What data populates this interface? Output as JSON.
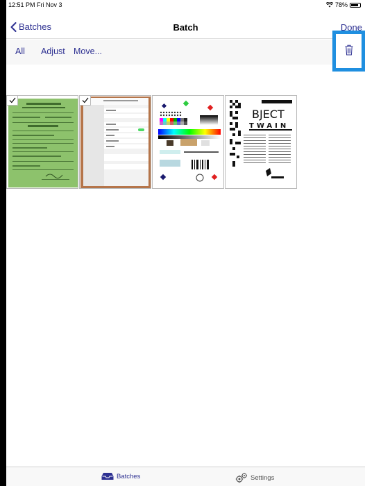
{
  "status_bar": {
    "time": "12:51 PM  Fri Nov 3",
    "battery": "78%"
  },
  "nav": {
    "back_label": "Batches",
    "title": "Batch",
    "done_label": "Done"
  },
  "toolbar": {
    "all_label": "All",
    "adjust_label": "Adjust",
    "move_label": "Move..."
  },
  "thumbnails": [
    {
      "icon": "document-thumbnail",
      "checked": true
    },
    {
      "icon": "settings-screenshot-thumbnail",
      "checked": true
    },
    {
      "icon": "color-test-chart-thumbnail",
      "checked": false
    },
    {
      "icon": "object-twain-page-thumbnail",
      "checked": false
    }
  ],
  "tabbar": {
    "batches_label": "Batches",
    "settings_label": "Settings"
  },
  "colors": {
    "accent": "#2e3192",
    "highlight": "#1f8fe0",
    "doc_green": "#8dc26c"
  }
}
